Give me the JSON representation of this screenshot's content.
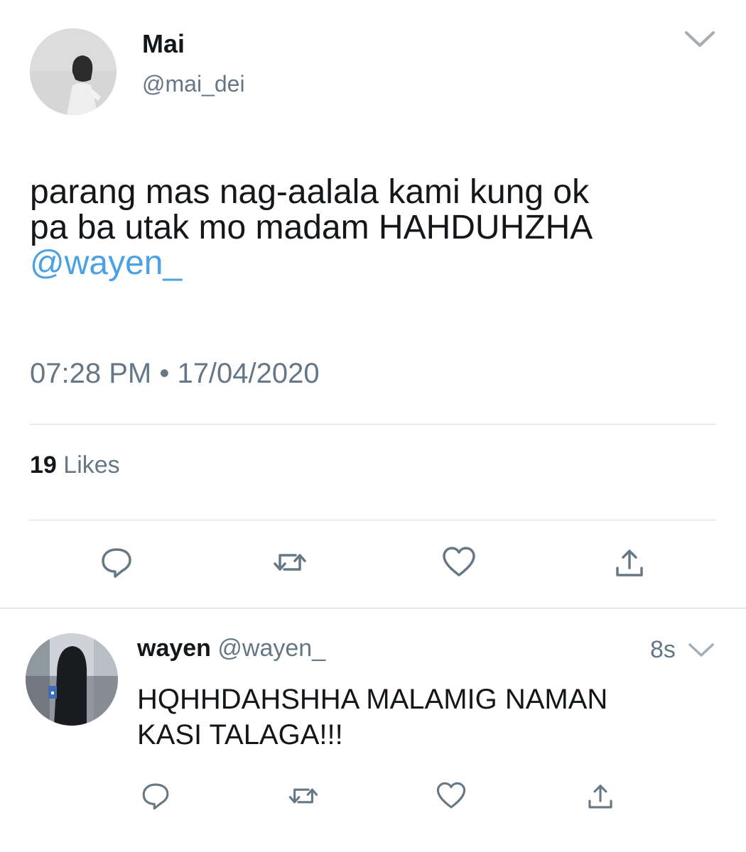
{
  "tweet": {
    "display_name": "Mai",
    "handle": "@mai_dei",
    "text_lines": [
      "parang mas nag-aalala kami kung ok",
      "pa ba utak mo madam HAHDUHZHA"
    ],
    "mention": "@wayen_",
    "timestamp": "07:28 PM • 17/04/2020",
    "likes_count": "19",
    "likes_label": "Likes",
    "more_icon": "chevron-down-icon",
    "actions": [
      "reply-icon",
      "retweet-icon",
      "like-icon",
      "share-icon"
    ]
  },
  "reply": {
    "display_name": "wayen",
    "handle": "@wayen_",
    "time": "8s",
    "text_lines": [
      "HQHHDAHSHHA MALAMIG NAMAN",
      "KASI TALAGA!!!"
    ],
    "more_icon": "chevron-down-icon",
    "actions": [
      "reply-icon",
      "retweet-icon",
      "like-icon",
      "share-icon"
    ]
  },
  "colors": {
    "text": "#14171a",
    "secondary": "#657786",
    "mention": "#4aa1e6",
    "divider": "#d9dde0",
    "icon": "#667886"
  }
}
